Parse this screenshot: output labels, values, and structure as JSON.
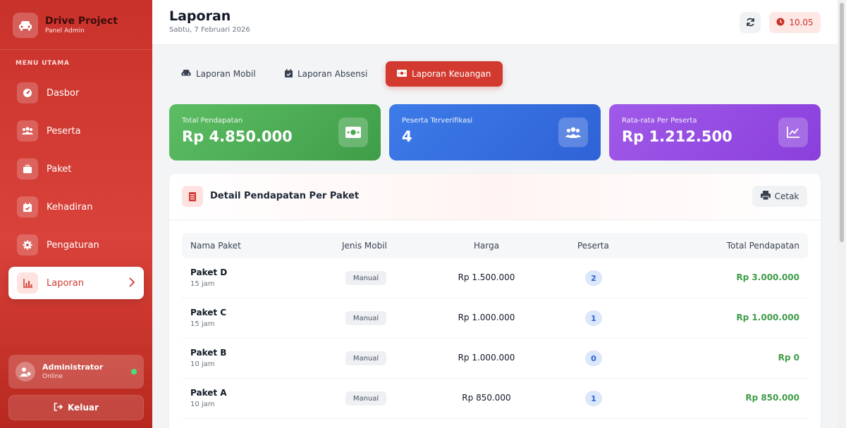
{
  "sidebar": {
    "brand_title": "Drive Project",
    "brand_subtitle": "Panel Admin",
    "menu_title": "MENU UTAMA",
    "items": [
      {
        "label": "Dasbor",
        "icon": "dashboard-icon"
      },
      {
        "label": "Peserta",
        "icon": "users-icon"
      },
      {
        "label": "Paket",
        "icon": "briefcase-icon"
      },
      {
        "label": "Kehadiran",
        "icon": "calendar-check-icon"
      },
      {
        "label": "Pengaturan",
        "icon": "gear-icon"
      },
      {
        "label": "Laporan",
        "icon": "chart-icon",
        "active": true
      }
    ],
    "user_name": "Administrator",
    "user_status": "Online",
    "logout_label": "Keluar"
  },
  "header": {
    "title": "Laporan",
    "date": "Sabtu, 7 Februari 2026",
    "time": "10.05"
  },
  "tabs": [
    {
      "label": "Laporan Mobil",
      "icon": "car-icon"
    },
    {
      "label": "Laporan Absensi",
      "icon": "calendar-icon"
    },
    {
      "label": "Laporan Keuangan",
      "icon": "money-icon",
      "active": true
    }
  ],
  "stats": [
    {
      "label": "Total Pendapatan",
      "value": "Rp 4.850.000",
      "icon": "money-icon"
    },
    {
      "label": "Peserta Terverifikasi",
      "value": "4",
      "icon": "users-icon"
    },
    {
      "label": "Rata-rata Per Peserta",
      "value": "Rp 1.212.500",
      "icon": "line-chart-icon"
    }
  ],
  "detail": {
    "title": "Detail Pendapatan Per Paket",
    "print_label": "Cetak",
    "columns": [
      "Nama Paket",
      "Jenis Mobil",
      "Harga",
      "Peserta",
      "Total Pendapatan"
    ],
    "rows": [
      {
        "name": "Paket D",
        "hours": "15 jam",
        "type": "Manual",
        "price": "Rp 1.500.000",
        "count": "2",
        "total": "Rp 3.000.000"
      },
      {
        "name": "Paket C",
        "hours": "15 jam",
        "type": "Manual",
        "price": "Rp 1.000.000",
        "count": "1",
        "total": "Rp 1.000.000"
      },
      {
        "name": "Paket B",
        "hours": "10 jam",
        "type": "Manual",
        "price": "Rp 1.000.000",
        "count": "0",
        "total": "Rp 0"
      },
      {
        "name": "Paket A",
        "hours": "10 jam",
        "type": "Manual",
        "price": "Rp 850.000",
        "count": "1",
        "total": "Rp 850.000"
      }
    ]
  },
  "colors": {
    "brand_red": "#d23a30",
    "green": "#3f9d48",
    "blue": "#2f62d6",
    "purple": "#8a3fdc"
  }
}
